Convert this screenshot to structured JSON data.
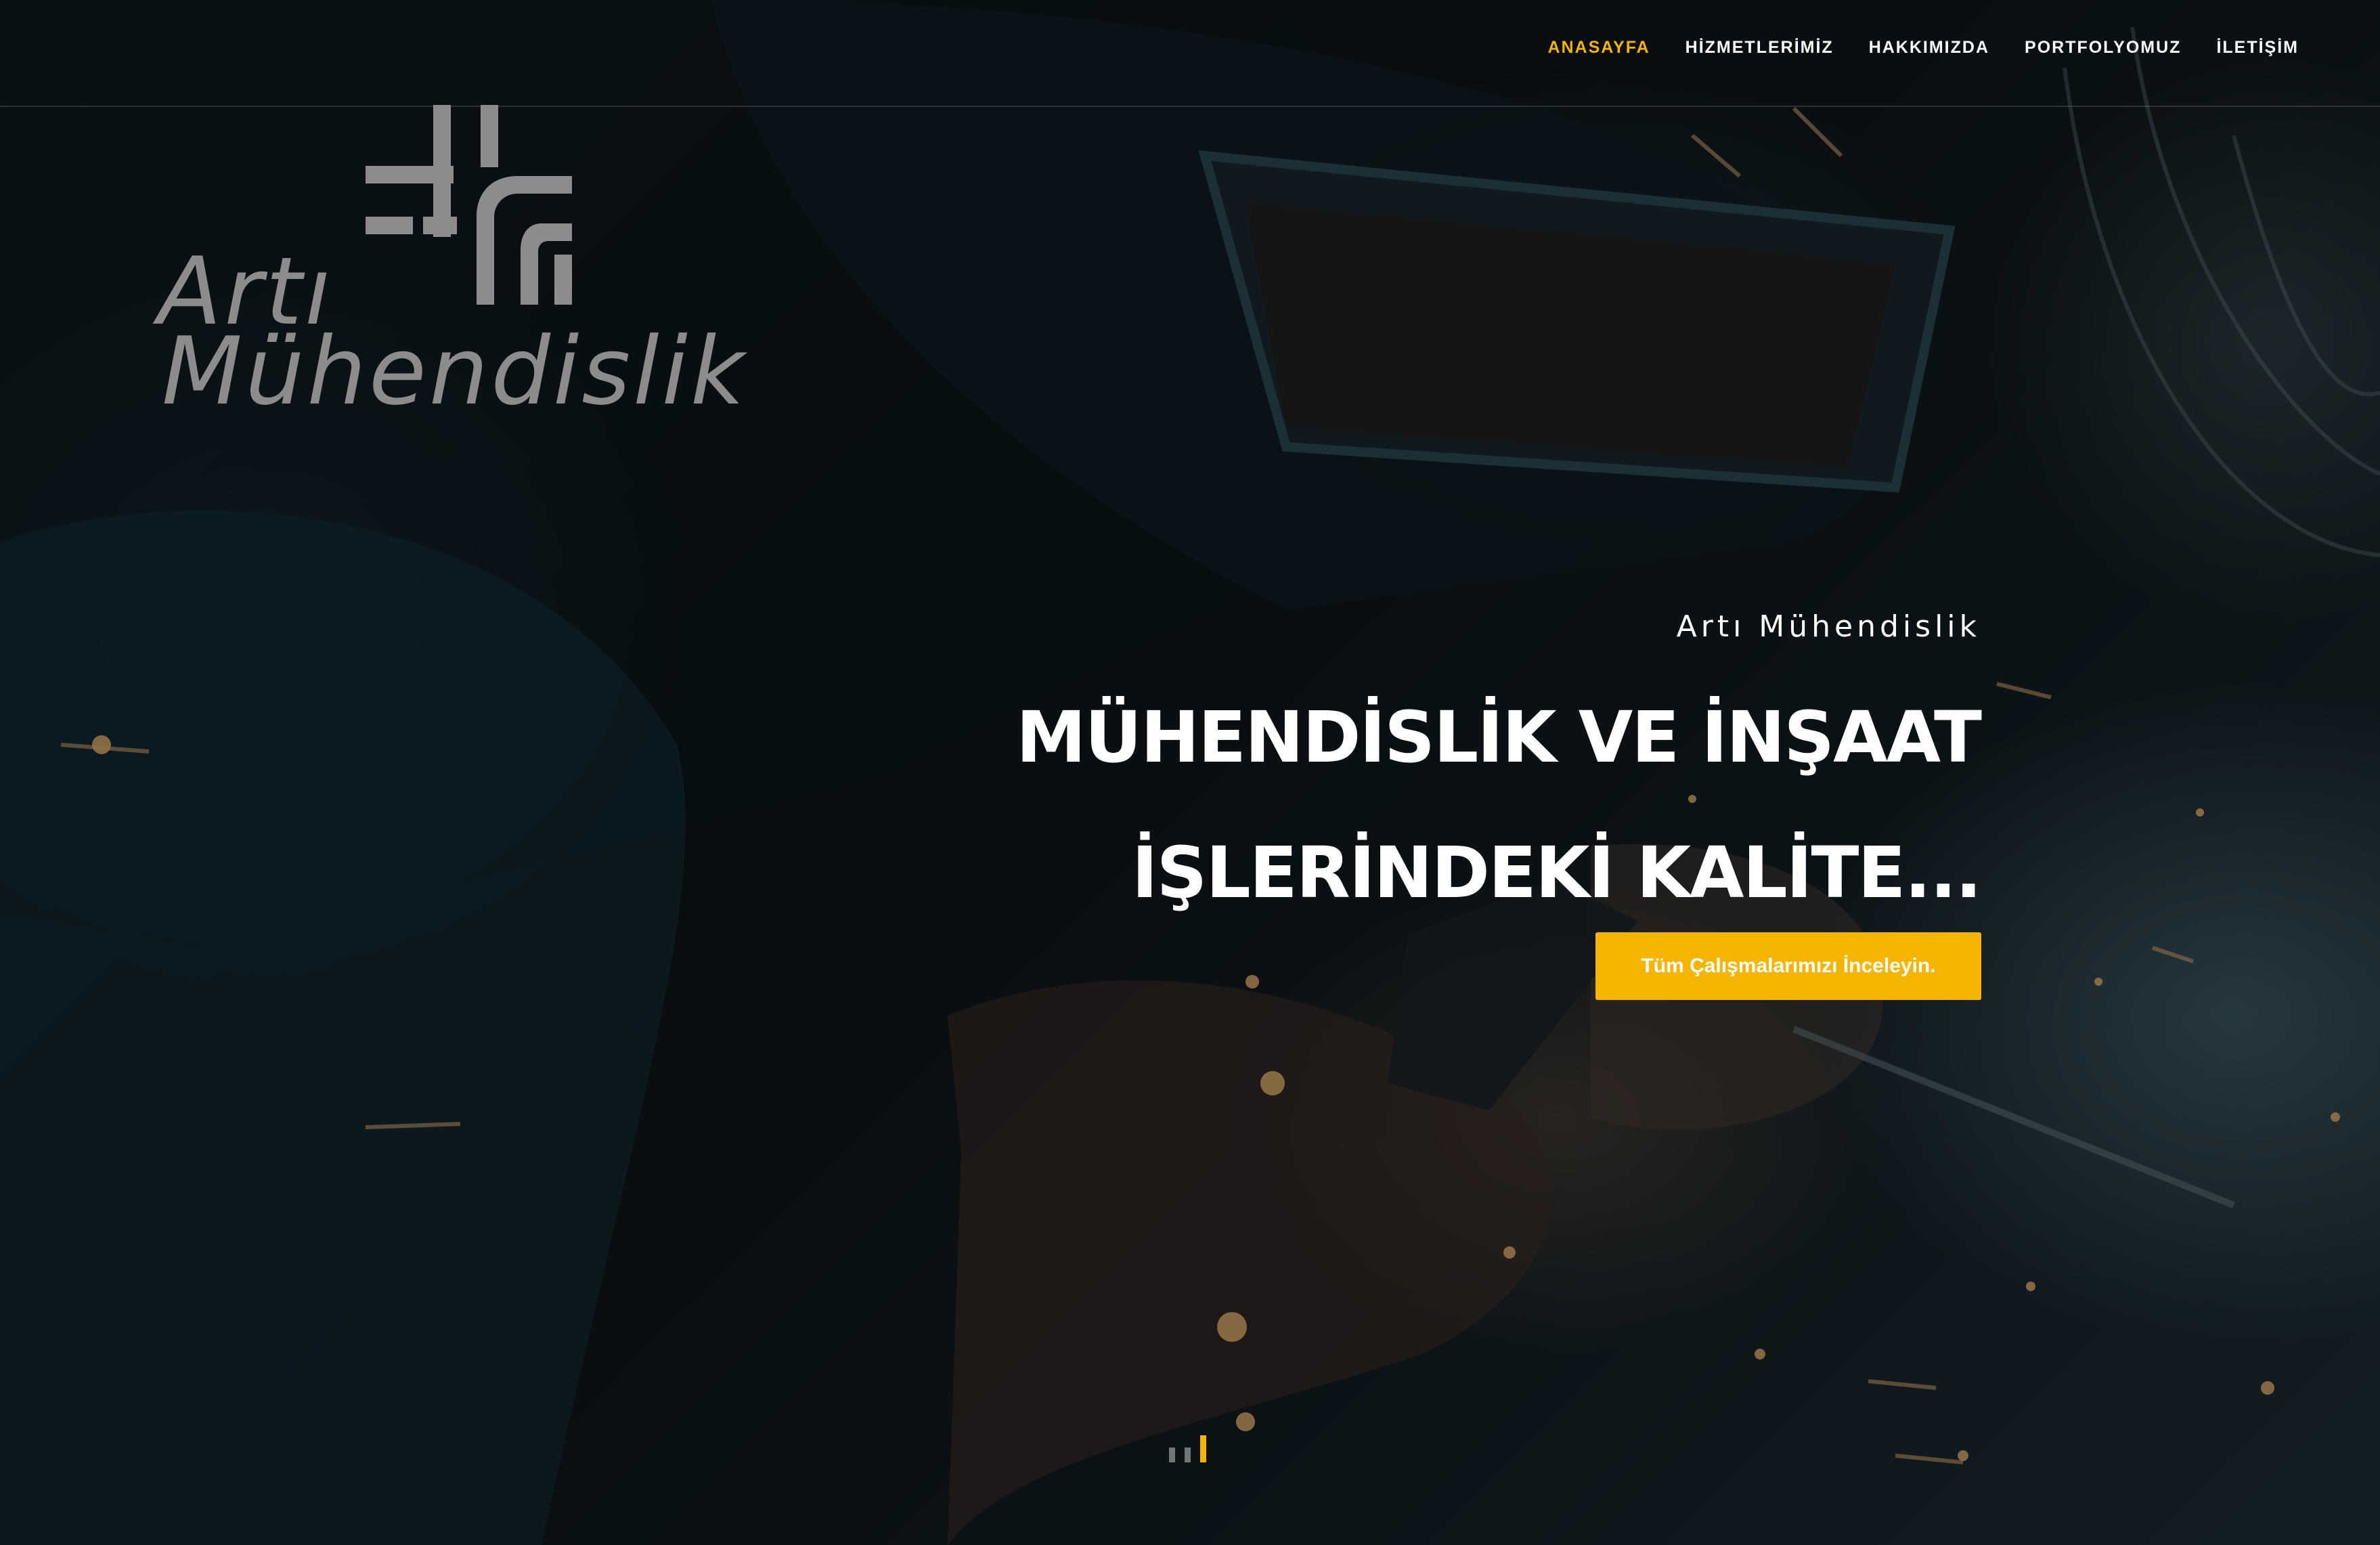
{
  "nav": {
    "items": [
      {
        "label": "ANASAYFA",
        "active": true
      },
      {
        "label": "HİZMETLERİMİZ",
        "active": false
      },
      {
        "label": "HAKKIMIZDA",
        "active": false
      },
      {
        "label": "PORTFOLYOMUZ",
        "active": false
      },
      {
        "label": "İLETİŞİM",
        "active": false
      }
    ]
  },
  "logo": {
    "line1": "Artı",
    "line2": "Mühendislik",
    "icon": "plus-bracket-logo-icon",
    "color": "#8c8c8c"
  },
  "hero": {
    "subtitle": "Artı Mühendislik",
    "headline_line1": "MÜHENDİSLİK VE İNŞAAT",
    "headline_line2": "İŞLERİNDEKİ KALİTE...",
    "cta_label": "Tüm Çalışmalarımızı İnceleyin."
  },
  "slider": {
    "slides": 3,
    "active_index": 2
  },
  "colors": {
    "accent": "#f5b400",
    "text": "#ffffff",
    "background": "#0b1114"
  }
}
